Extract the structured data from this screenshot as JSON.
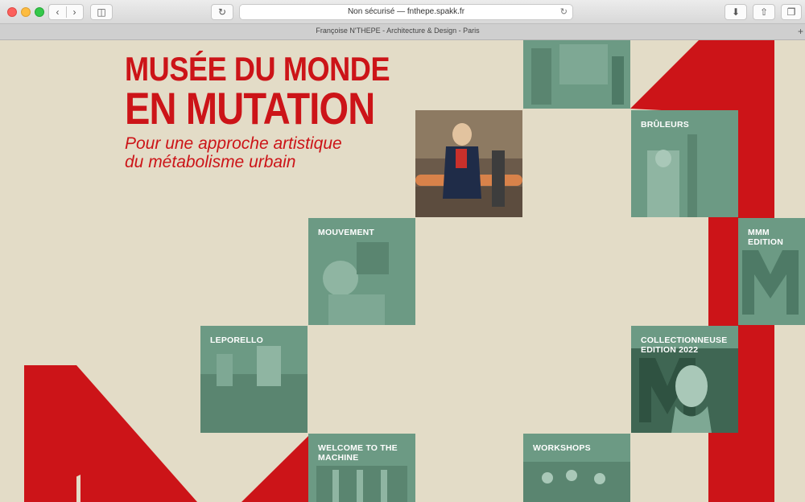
{
  "browser": {
    "address": "Non sécurisé — fnthepe.spakk.fr",
    "tab_title": "Françoise N'THEPE - Architecture & Design - Paris",
    "accent": "#cc1418"
  },
  "hero": {
    "line1": "MUSÉE DU MONDE",
    "line2": "EN MUTATION",
    "sub1": "Pour une approche artistique",
    "sub2": "du métabolisme urbain"
  },
  "tiles": {
    "top": "",
    "bruleurs": "BRÛLEURS",
    "mouvement": "MOUVEMENT",
    "mmm": "MMM EDITION",
    "leporello": "LEPORELLO",
    "collectionneuse": "COLLECTIONNEUSE EDITION 2022",
    "welcome": "WELCOME TO THE MACHINE",
    "workshops": "WORKSHOPS"
  },
  "colors": {
    "tile_green": "#6c9a84",
    "background": "#e3dcc7",
    "red": "#cc1418"
  }
}
